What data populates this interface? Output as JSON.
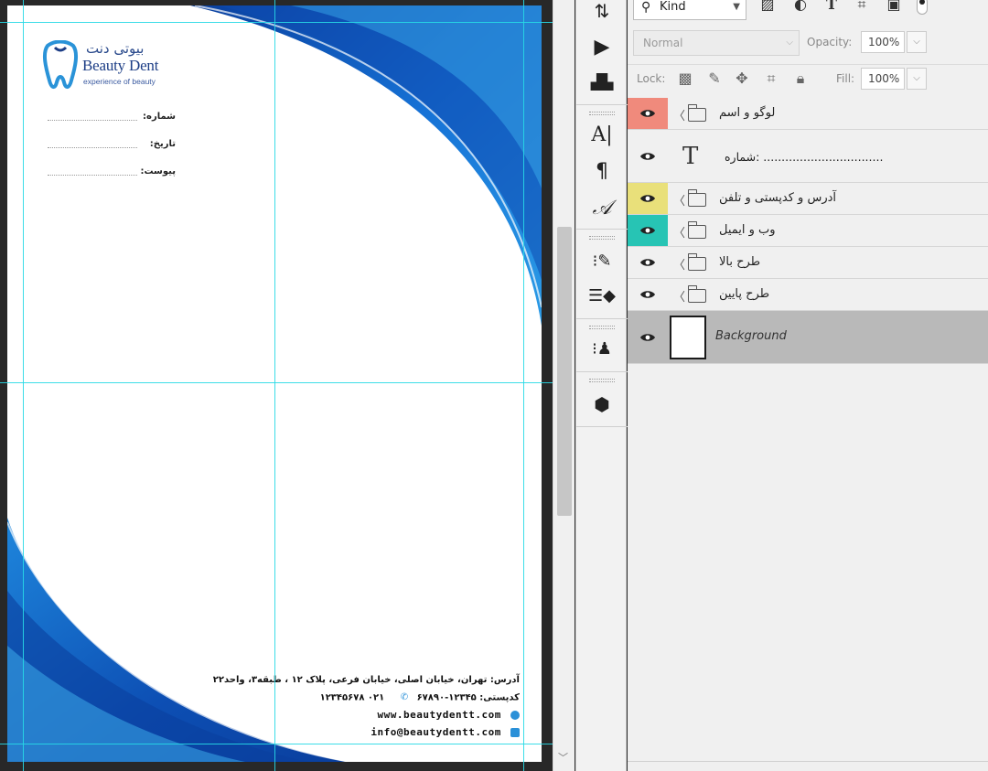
{
  "document": {
    "logo": {
      "name_fa": "بیوتی دنت",
      "name_en": "Beauty Dent",
      "tagline": "experience of beauty"
    },
    "fields": [
      {
        "label": "شماره:"
      },
      {
        "label": "تاریخ:"
      },
      {
        "label": "پیوست:"
      }
    ],
    "footer": {
      "address": "آدرس: تهران، خیابان اصلی، خیابان فرعی، پلاک ۱۲ ، طبقه۳، واحد۲۲",
      "postal_label": "کدپستی: ۱۲۳۴۵-۶۷۸۹۰",
      "phone": "۰۲۱ ۱۲۳۴۵۶۷۸",
      "website": "www.beautydentt.com",
      "email": "info@beautydentt.com"
    },
    "colors": {
      "wave_dark": "#0a3f9e",
      "wave_mid": "#1672d6",
      "wave_light": "#3fb3ef",
      "logo": "#1d3e86"
    }
  },
  "tools": [
    {
      "icon": "history-brush-icon"
    },
    {
      "icon": "play-action-icon"
    },
    {
      "icon": "tool-preset-icon"
    },
    {
      "icon": "character-icon"
    },
    {
      "icon": "paragraph-icon"
    },
    {
      "icon": "glyphs-icon"
    },
    {
      "icon": "brush-settings-icon"
    },
    {
      "icon": "brush-presets-icon"
    },
    {
      "icon": "clone-source-icon"
    },
    {
      "icon": "3d-icon"
    }
  ],
  "layers_panel": {
    "filter": {
      "kind_label": "Kind"
    },
    "blend_mode": "Normal",
    "opacity_label": "Opacity:",
    "opacity_value": "100%",
    "lock_label": "Lock:",
    "fill_label": "Fill:",
    "fill_value": "100%",
    "layers": [
      {
        "type": "group",
        "name": "لوگو و اسم",
        "color": "#f08a7c"
      },
      {
        "type": "text",
        "name": "شماره: .................................",
        "color": ""
      },
      {
        "type": "group",
        "name": "آدرس و کدپستی و تلفن",
        "color": "#e9e07a"
      },
      {
        "type": "group",
        "name": "وب و ایمیل",
        "color": "#27c4b4"
      },
      {
        "type": "group",
        "name": "طرح بالا",
        "color": ""
      },
      {
        "type": "group",
        "name": "طرح پایین",
        "color": ""
      },
      {
        "type": "background",
        "name": "Background",
        "color": ""
      }
    ]
  }
}
